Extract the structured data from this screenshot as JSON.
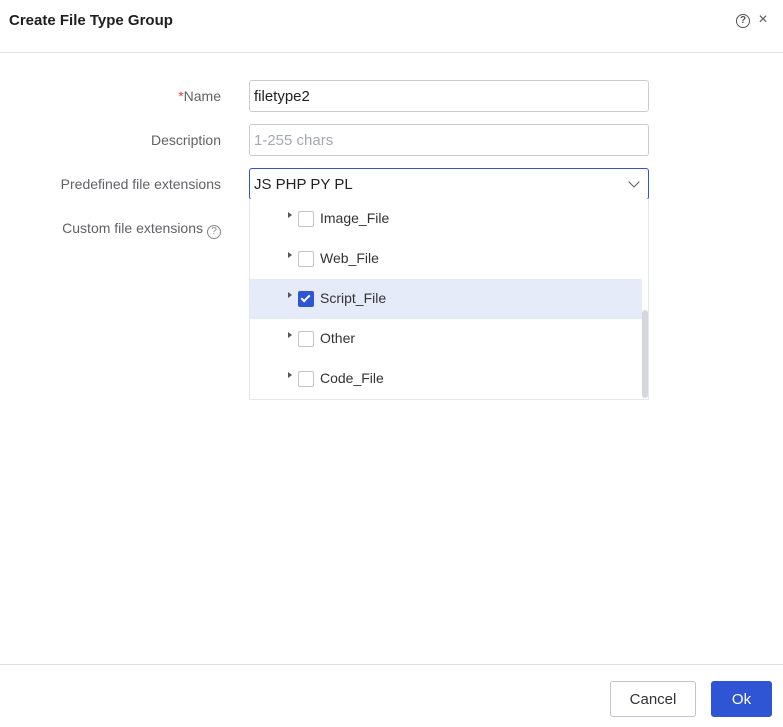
{
  "dialog": {
    "title": "Create File Type Group",
    "help_glyph": "?",
    "close_glyph": "×"
  },
  "form": {
    "name": {
      "required_mark": "*",
      "label": "Name",
      "value": "filetype2"
    },
    "description": {
      "label": "Description",
      "placeholder": "1-255 chars"
    },
    "predefined": {
      "label": "Predefined file extensions",
      "value": "JS PHP PY PL"
    },
    "custom": {
      "label": "Custom file extensions",
      "help_glyph": "?"
    }
  },
  "dropdown": {
    "items": [
      {
        "label": "Image_File",
        "checked": false
      },
      {
        "label": "Web_File",
        "checked": false
      },
      {
        "label": "Script_File",
        "checked": true
      },
      {
        "label": "Other",
        "checked": false
      },
      {
        "label": "Code_File",
        "checked": false
      }
    ]
  },
  "footer": {
    "cancel_label": "Cancel",
    "ok_label": "Ok"
  },
  "colors": {
    "primary": "#2f55d4",
    "selected_row": "#e6ebfa",
    "required": "#e64545"
  }
}
